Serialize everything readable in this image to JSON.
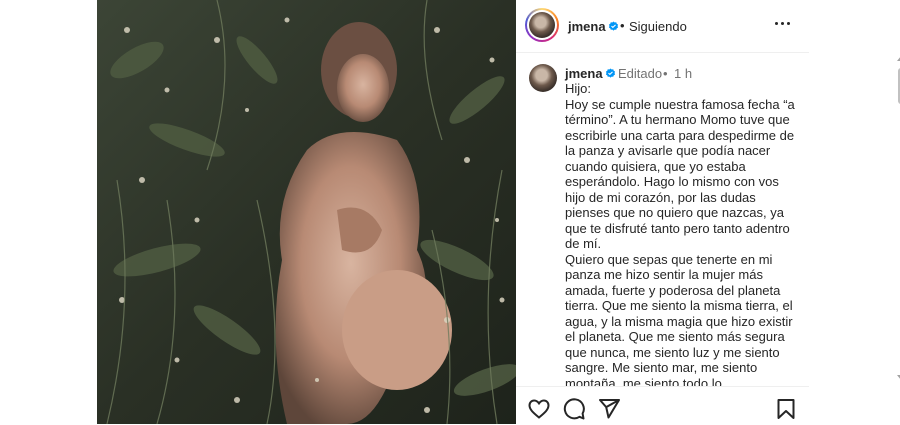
{
  "header": {
    "username": "jmena",
    "separator": "•",
    "follow_status": "Siguiendo"
  },
  "caption": {
    "username": "jmena",
    "edited_label": "Editado",
    "separator": "•",
    "timestamp": "1 h",
    "text": "Hijo:\nHoy se cumple nuestra famosa fecha “a término”. A tu hermano Momo tuve que escribirle una carta para despedirme de la panza y avisarle que podía nacer cuando quisiera, que yo estaba esperándolo. Hago lo mismo con vos hijo de mi corazón, por las dudas pienses que no quiero que nazcas, ya que te disfruté tanto pero tanto adentro de mí.\nQuiero que sepas que tenerte en mi panza me hizo sentir la mujer más amada, fuerte y poderosa del planeta tierra. Que me siento la misma tierra, el agua, y la misma magia que hizo existir el planeta. Que me siento más segura que nunca, me siento luz y me siento sangre. Me siento mar, me siento montaña, me siento todo lo..."
  },
  "colors": {
    "verified": "#0095f6",
    "text": "#262626",
    "muted": "#737373"
  },
  "icons": {
    "verified": "verified-badge-icon",
    "more": "more-options-icon",
    "like": "heart-icon",
    "comment": "comment-icon",
    "share": "share-icon",
    "save": "bookmark-icon"
  }
}
